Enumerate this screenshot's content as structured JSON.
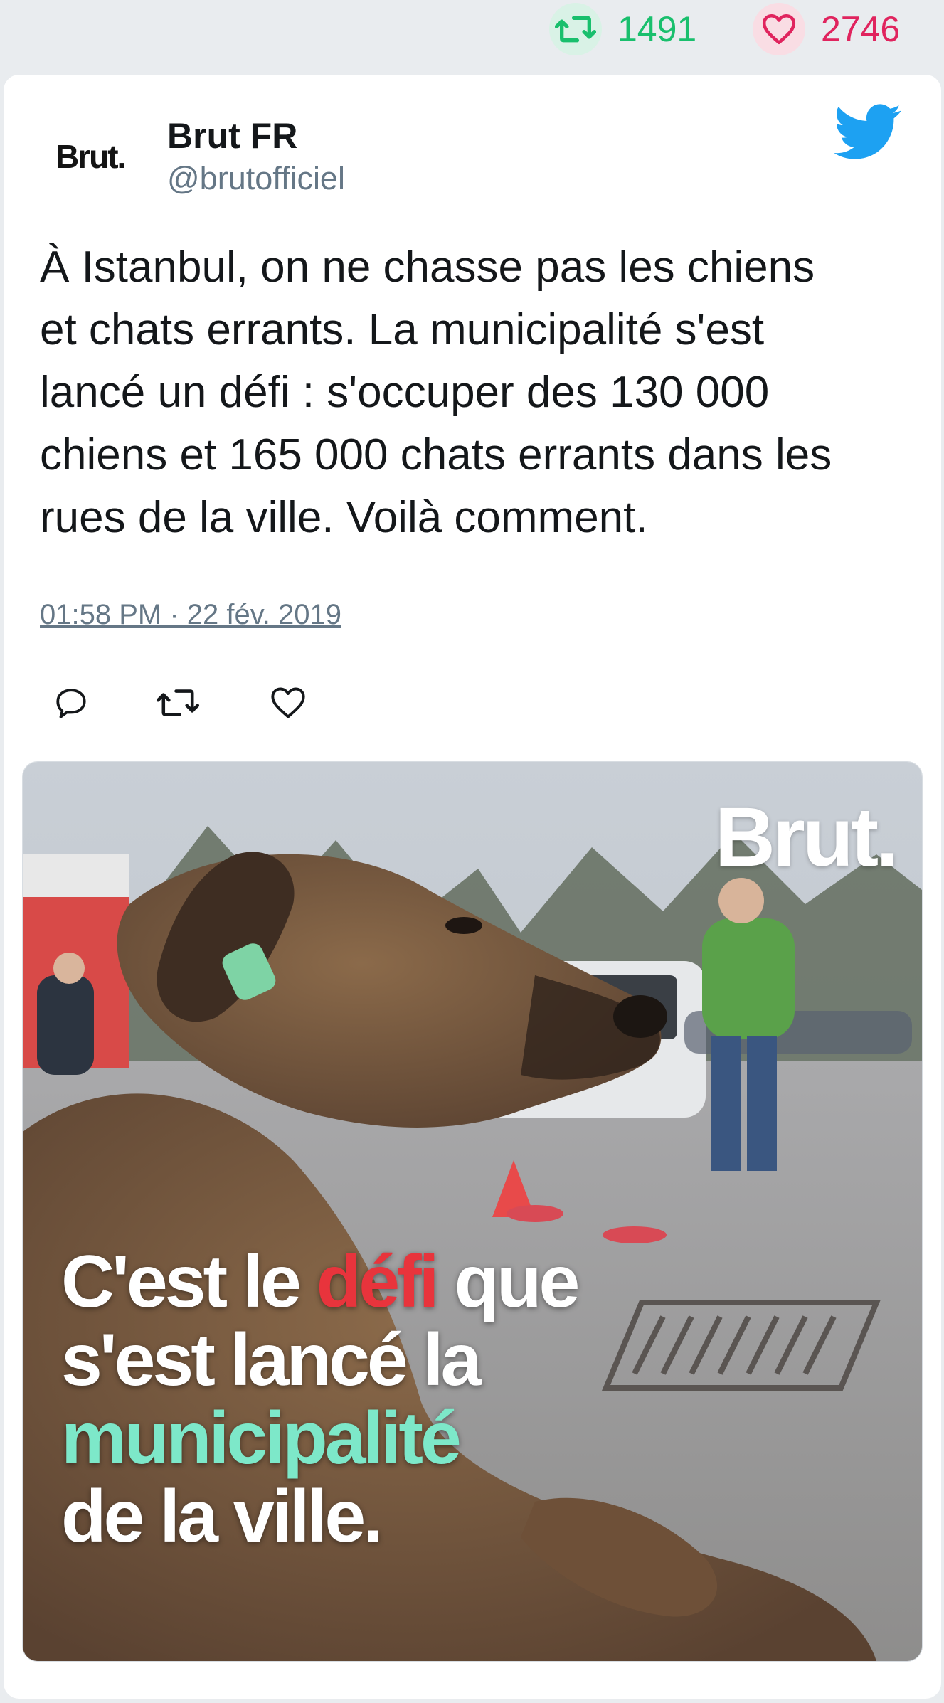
{
  "stats": {
    "retweets": "1491",
    "likes": "2746",
    "retweet_color": "#19bf6d",
    "like_color": "#e0245e"
  },
  "author": {
    "logo_text": "Brut.",
    "name": "Brut FR",
    "handle": "@brutofficiel"
  },
  "tweet": {
    "text": "À Istanbul, on ne chasse pas les chiens\net chats errants. La municipalité s'est\nlancé un défi : s'occuper des 130 000\nchiens et 165 000 chats errants dans les\nrues de la ville. Voilà comment.",
    "timestamp": "01:58 PM · 22 fév. 2019"
  },
  "icons": {
    "brand": "twitter-bird-icon",
    "reply": "reply-icon",
    "retweet": "retweet-icon",
    "like": "heart-icon"
  },
  "media": {
    "watermark": "Brut.",
    "caption": {
      "line1_a": "C'est le ",
      "line1_b": "défi",
      "line1_c": " que",
      "line2": "s'est lancé la",
      "line3": "municipalité",
      "line4": "de la ville."
    }
  }
}
